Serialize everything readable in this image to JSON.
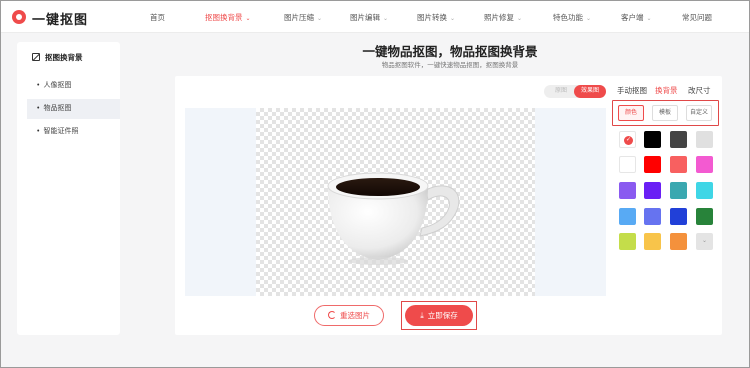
{
  "brand": {
    "name": "一键抠图",
    "logo_icon": "logo-circle-icon"
  },
  "nav": [
    {
      "label": "首页",
      "caret": false,
      "active": false
    },
    {
      "label": "抠图换背景",
      "caret": true,
      "active": true
    },
    {
      "label": "图片压缩",
      "caret": true,
      "active": false
    },
    {
      "label": "图片编辑",
      "caret": true,
      "active": false
    },
    {
      "label": "图片转换",
      "caret": true,
      "active": false
    },
    {
      "label": "照片修复",
      "caret": true,
      "active": false
    },
    {
      "label": "特色功能",
      "caret": true,
      "active": false
    },
    {
      "label": "客户端",
      "caret": true,
      "active": false
    },
    {
      "label": "常见问题",
      "caret": false,
      "active": false
    }
  ],
  "sidebar": {
    "title": "抠图换背景",
    "items": [
      {
        "label": "人像抠图",
        "active": false
      },
      {
        "label": "物品抠图",
        "active": true
      },
      {
        "label": "智能证件照",
        "active": false
      }
    ]
  },
  "main": {
    "title": "一键物品抠图，物品抠图换背景",
    "subtitle": "物品抠图软件，一键快速物品抠图，抠图换背景"
  },
  "toggle": {
    "original": "原图",
    "result": "效果图"
  },
  "panel": {
    "tabs": [
      "手动抠图",
      "换背景",
      "改尺寸"
    ],
    "active_tab": 1,
    "options": [
      "颜色",
      "模板",
      "自定义"
    ],
    "active_option": 0,
    "swatches": [
      "selected",
      "#000000",
      "#444444",
      "#e0e0e0",
      "#ffffff",
      "#ff0000",
      "#f86060",
      "#f35ad1",
      "#8a5af0",
      "#6a1ff5",
      "#3aa8b0",
      "#3fd6e6",
      "#58aaf4",
      "#6673f0",
      "#2140d8",
      "#28833a",
      "#c4dd4a",
      "#f8c44a",
      "#f4913c",
      "more"
    ]
  },
  "buttons": {
    "reselect": "重选图片",
    "save": "立即保存"
  },
  "colors": {
    "accent": "#ef4b4b",
    "background": "#f5f5f6",
    "canvas_bg": "#f1f5fa"
  }
}
